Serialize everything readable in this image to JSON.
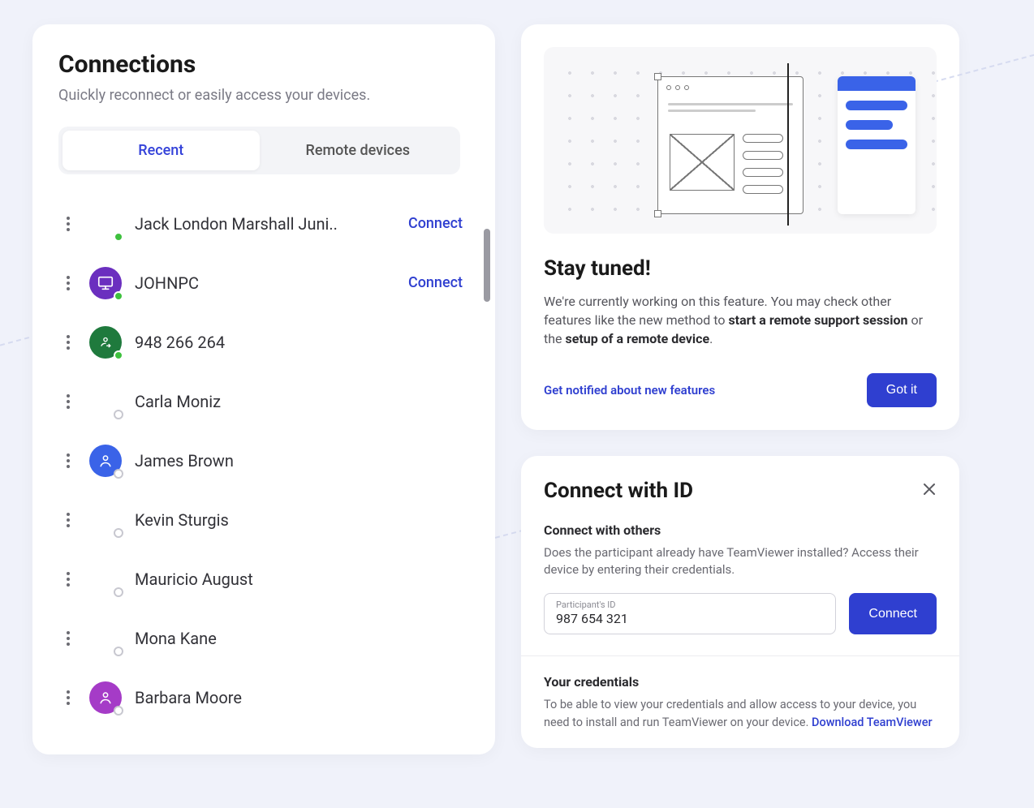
{
  "connections": {
    "title": "Connections",
    "subtitle": "Quickly reconnect or easily access your devices.",
    "tabs": {
      "recent": "Recent",
      "remote": "Remote devices"
    },
    "connect_label": "Connect",
    "items": [
      {
        "name": "Jack London Marshall Juni..",
        "status": "online",
        "avatar": "blank",
        "icon": "none",
        "show_connect": true
      },
      {
        "name": "JOHNPC",
        "status": "online",
        "avatar": "purple",
        "icon": "monitor",
        "show_connect": true
      },
      {
        "name": "948 266 264",
        "status": "online",
        "avatar": "green",
        "icon": "swap",
        "show_connect": false
      },
      {
        "name": "Carla Moniz",
        "status": "offline",
        "avatar": "blank",
        "icon": "none",
        "show_connect": false
      },
      {
        "name": "James Brown",
        "status": "offline",
        "avatar": "blue",
        "icon": "person",
        "show_connect": false
      },
      {
        "name": "Kevin Sturgis",
        "status": "offline",
        "avatar": "blank",
        "icon": "none",
        "show_connect": false
      },
      {
        "name": "Mauricio August",
        "status": "offline",
        "avatar": "blank",
        "icon": "none",
        "show_connect": false
      },
      {
        "name": "Mona Kane",
        "status": "offline",
        "avatar": "blank",
        "icon": "none",
        "show_connect": false
      },
      {
        "name": "Barbara Moore",
        "status": "offline",
        "avatar": "magenta",
        "icon": "person",
        "show_connect": false
      }
    ]
  },
  "promo": {
    "title": "Stay tuned!",
    "body_pre": "We're currently working on this feature. You may check other features like the new method to ",
    "bold1": "start a remote support session",
    "body_mid": " or the ",
    "bold2": "setup of a remote device",
    "body_post": ".",
    "notify_link": "Get notified about new features",
    "gotit": "Got it"
  },
  "connectId": {
    "title": "Connect with ID",
    "section1_title": "Connect with others",
    "section1_text": "Does the participant already have TeamViewer installed? Access their device by entering their credentials.",
    "id_label": "Participant's ID",
    "id_value": "987 654 321",
    "connect_btn": "Connect",
    "section2_title": "Your credentials",
    "section2_text": "To be able to view your credentials and allow access to your device, you need to install and run TeamViewer on your device.  ",
    "download_link": "Download TeamViewer"
  }
}
